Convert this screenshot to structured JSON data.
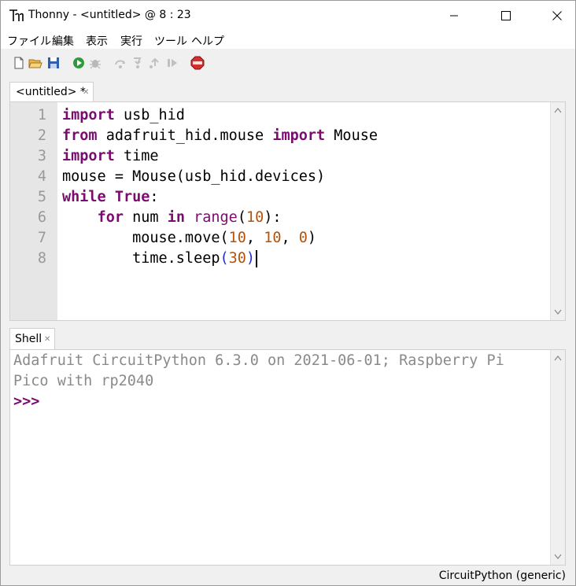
{
  "window": {
    "title": "Thonny  -  <untitled>  @  8 : 23",
    "controls": {
      "minimize": "minimize-icon",
      "maximize": "maximize-icon",
      "close": "close-icon"
    }
  },
  "menu": [
    "ファイル",
    "編集",
    "表示",
    "実行",
    "ツール",
    "ヘルプ"
  ],
  "toolbar": [
    "new-file-icon",
    "open-file-icon",
    "save-icon",
    "run-icon",
    "debug-icon",
    "step-over-icon",
    "step-into-icon",
    "step-out-icon",
    "resume-icon",
    "stop-icon"
  ],
  "editor": {
    "tab_label": "<untitled> *",
    "line_numbers": [
      "1",
      "2",
      "3",
      "4",
      "5",
      "6",
      "7",
      "8"
    ],
    "lines": [
      "import usb_hid",
      "from adafruit_hid.mouse import Mouse",
      "import time",
      "mouse = Mouse(usb_hid.devices)",
      "while True:",
      "    for num in range(10):",
      "        mouse.move(10, 10, 0)",
      "        time.sleep(30)"
    ]
  },
  "shell": {
    "tab_label": "Shell",
    "output": [
      "Adafruit CircuitPython 6.3.0 on 2021-06-01; Raspberry Pi",
      "Pico with rp2040"
    ],
    "prompt": ">>>"
  },
  "status": {
    "interpreter": "CircuitPython (generic)"
  },
  "colors": {
    "keyword": "#7a0b6f",
    "number": "#b45309",
    "gutter": "#e6e6e6",
    "stop": "#d32f2f",
    "run": "#2e9b3a"
  }
}
